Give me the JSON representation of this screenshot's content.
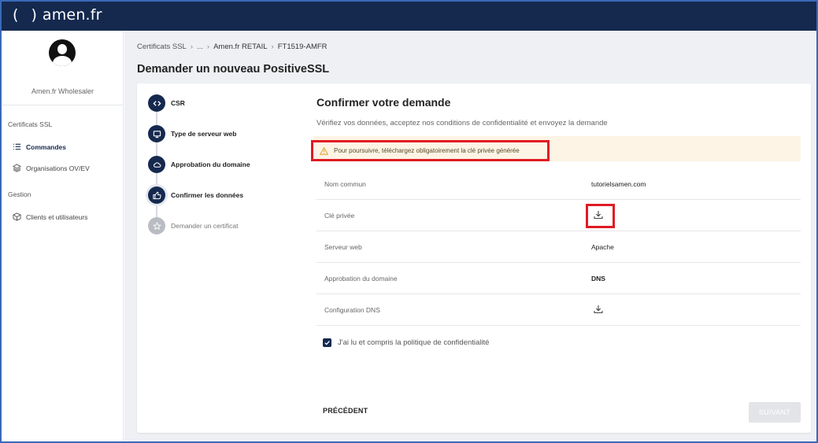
{
  "header": {
    "logo_paren": "( )",
    "logo_text": "amen.fr"
  },
  "sidebar": {
    "account_name": "Amen.fr Wholesaler",
    "groups": [
      {
        "label": "Certificats SSL",
        "items": [
          {
            "label": "Commandes",
            "icon": "list-icon",
            "active": true
          },
          {
            "label": "Organisations OV/EV",
            "icon": "layers-icon",
            "active": false
          }
        ]
      },
      {
        "label": "Gestion",
        "items": [
          {
            "label": "Clients et utilisateurs",
            "icon": "cube-icon",
            "active": false
          }
        ]
      }
    ]
  },
  "breadcrumb": [
    "Certificats SSL",
    "...",
    "Amen.fr RETAIL",
    "FT1519-AMFR"
  ],
  "page_title": "Demander un nouveau PositiveSSL",
  "steps": [
    {
      "label": "CSR",
      "icon": "code-icon",
      "state": "done"
    },
    {
      "label": "Type de serveur web",
      "icon": "monitor-icon",
      "state": "done"
    },
    {
      "label": "Approbation du domaine",
      "icon": "cloud-icon",
      "state": "done"
    },
    {
      "label": "Confirmer les données",
      "icon": "thumbs-up-icon",
      "state": "current"
    },
    {
      "label": "Demander un certificat",
      "icon": "star-icon",
      "state": "pending"
    }
  ],
  "confirm": {
    "title": "Confirmer votre demande",
    "subtitle": "Vérifiez vos données, acceptez nos conditions de confidentialité et envoyez la demande",
    "warning": "Pour poursuivre, téléchargez obligatoirement la clé privée générée"
  },
  "rows": [
    {
      "label": "Nom commun",
      "value": "tutorielsamen.com"
    },
    {
      "label": "Clé privée",
      "value": null,
      "icon": "download-icon"
    },
    {
      "label": "Serveur web",
      "value": "Apache"
    },
    {
      "label": "Approbation du domaine",
      "value": "DNS"
    },
    {
      "label": "Configuration DNS",
      "value": null,
      "icon": "download-icon"
    }
  ],
  "privacy": {
    "label": "J'ai lu et compris la politique de confidentialité",
    "checked": true
  },
  "buttons": {
    "previous": "PRÉCÉDENT",
    "next": "SUIVANT"
  },
  "colors": {
    "primary": "#15294f",
    "warning_bg": "#fdf4e5",
    "highlight": "#e01b22",
    "disabled": "#e3e4e7"
  }
}
